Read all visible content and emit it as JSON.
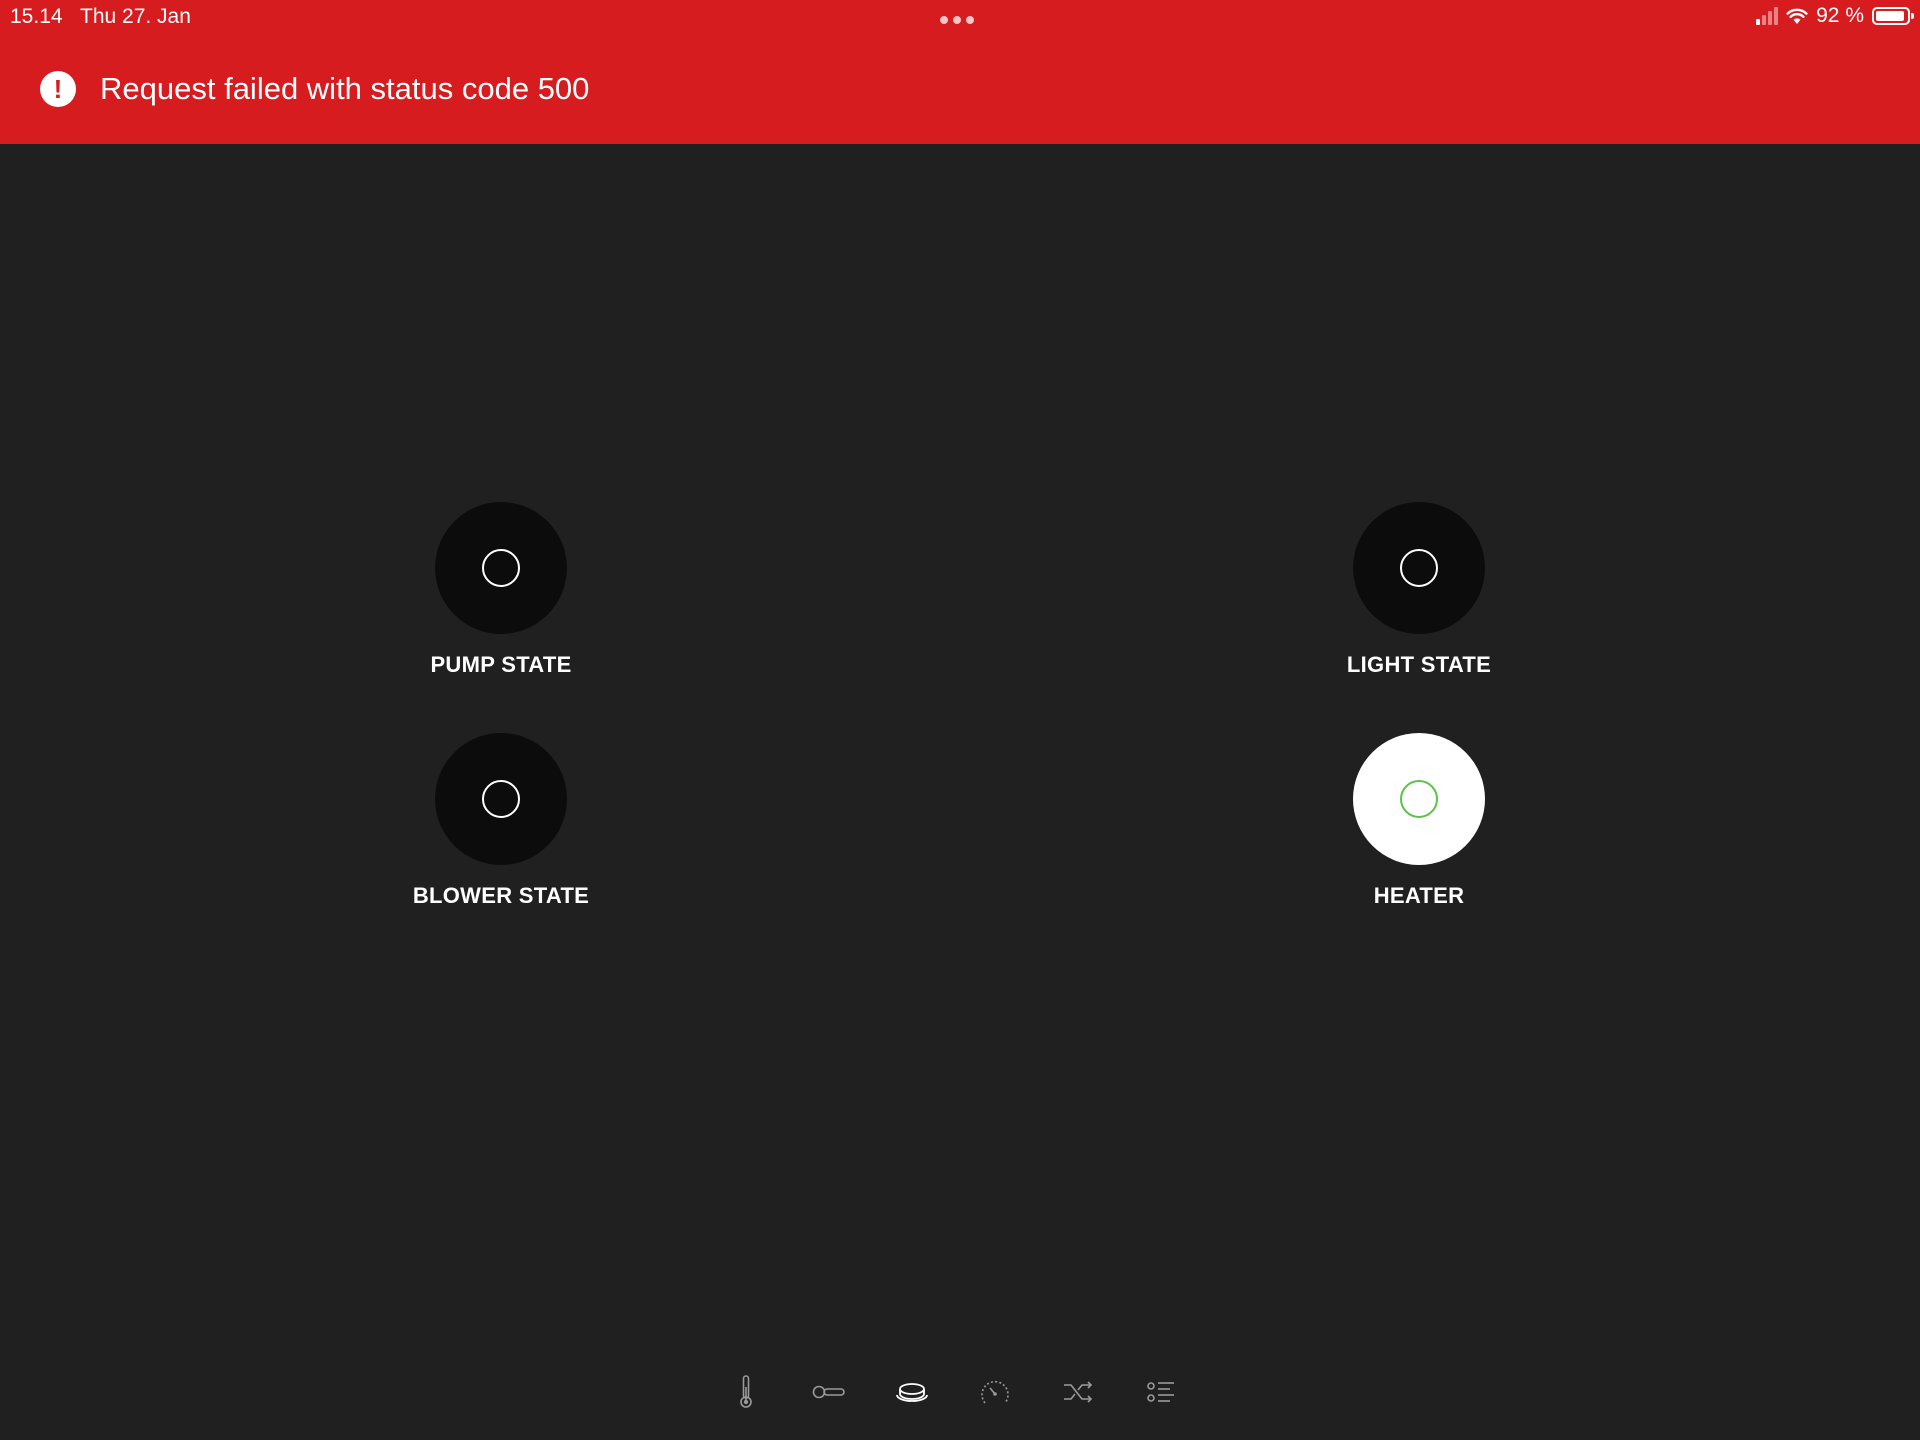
{
  "status_bar": {
    "time": "15.14",
    "date": "Thu 27. Jan",
    "battery_percent": "92 %",
    "battery_level": 0.92,
    "signal_bars_on": 1,
    "signal_bars_total": 4
  },
  "error_banner": {
    "message": "Request failed with status code 500",
    "icon": "alert-circle-icon",
    "color": "#d71c1f"
  },
  "controls": {
    "pump": {
      "label": "PUMP STATE",
      "active": false
    },
    "light": {
      "label": "LIGHT STATE",
      "active": false
    },
    "blower": {
      "label": "BLOWER STATE",
      "active": false
    },
    "heater": {
      "label": "HEATER",
      "active": true
    }
  },
  "bottom_nav": {
    "items": [
      {
        "icon": "thermometer-icon"
      },
      {
        "icon": "toggle-icon"
      },
      {
        "icon": "hot-tub-icon",
        "selected": true
      },
      {
        "icon": "gauge-icon"
      },
      {
        "icon": "shuffle-icon"
      },
      {
        "icon": "list-settings-icon"
      }
    ]
  },
  "colors": {
    "background": "#202020",
    "knob_off": "#0c0c0c",
    "knob_on": "#ffffff",
    "ring_on": "#5cc24a"
  }
}
